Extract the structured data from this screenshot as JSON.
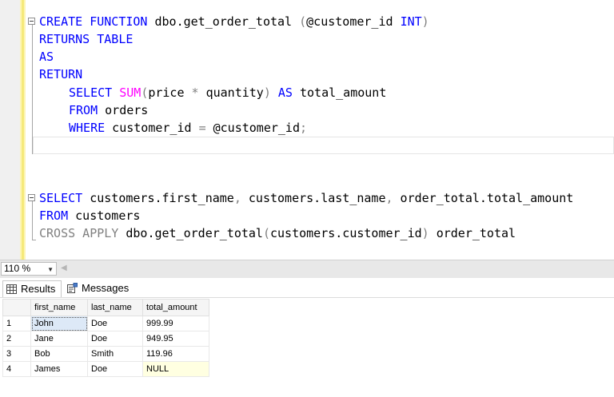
{
  "editor": {
    "function_block": {
      "line1": {
        "kw1": "CREATE",
        "kw2": "FUNCTION",
        "name": " dbo.get_order_total ",
        "paren_open": "(",
        "param": "@customer_id",
        "type": "INT",
        "paren_close": ")"
      },
      "line2": "RETURNS TABLE",
      "line3": "AS",
      "line4": "RETURN",
      "line5": {
        "kw_select": "SELECT",
        "fn_sum": "SUM",
        "expr_open": "(",
        "expr": "price ",
        "op": "*",
        "expr2": " quantity",
        "expr_close": ")",
        "kw_as": "AS",
        "alias": " total_amount"
      },
      "line6": {
        "kw_from": "FROM",
        "table": " orders"
      },
      "line7": {
        "kw_where": "WHERE",
        "col": " customer_id ",
        "op": "=",
        "param": " @customer_id",
        "semi": ";"
      }
    },
    "query_block": {
      "line1": {
        "kw_select": "SELECT",
        "cols": " customers.first_name",
        "c1": ",",
        "col2": " customers.last_name",
        "c2": ",",
        "col3": " order_total.total_amount"
      },
      "line2": {
        "kw_from": "FROM",
        "table": " customers"
      },
      "line3": {
        "kw_cross": "CROSS APPLY",
        "call": " dbo.get_order_total",
        "p_open": "(",
        "arg": "customers.customer_id",
        "p_close": ")",
        "alias": " order_total"
      }
    }
  },
  "zoom": {
    "value": "110 %"
  },
  "tabs": [
    {
      "label": "Results",
      "icon": "grid-icon"
    },
    {
      "label": "Messages",
      "icon": "messages-icon"
    }
  ],
  "results": {
    "columns": [
      "first_name",
      "last_name",
      "total_amount"
    ],
    "rows": [
      {
        "num": "1",
        "first_name": "John",
        "last_name": "Doe",
        "total_amount": "999.99"
      },
      {
        "num": "2",
        "first_name": "Jane",
        "last_name": "Doe",
        "total_amount": "949.95"
      },
      {
        "num": "3",
        "first_name": "Bob",
        "last_name": "Smith",
        "total_amount": "119.96"
      },
      {
        "num": "4",
        "first_name": "James",
        "last_name": "Doe",
        "total_amount": "NULL"
      }
    ]
  },
  "colors": {
    "keyword": "#0000ff",
    "function": "#ff00ff",
    "operator": "#808080",
    "change_bar": "#f5e97a"
  }
}
